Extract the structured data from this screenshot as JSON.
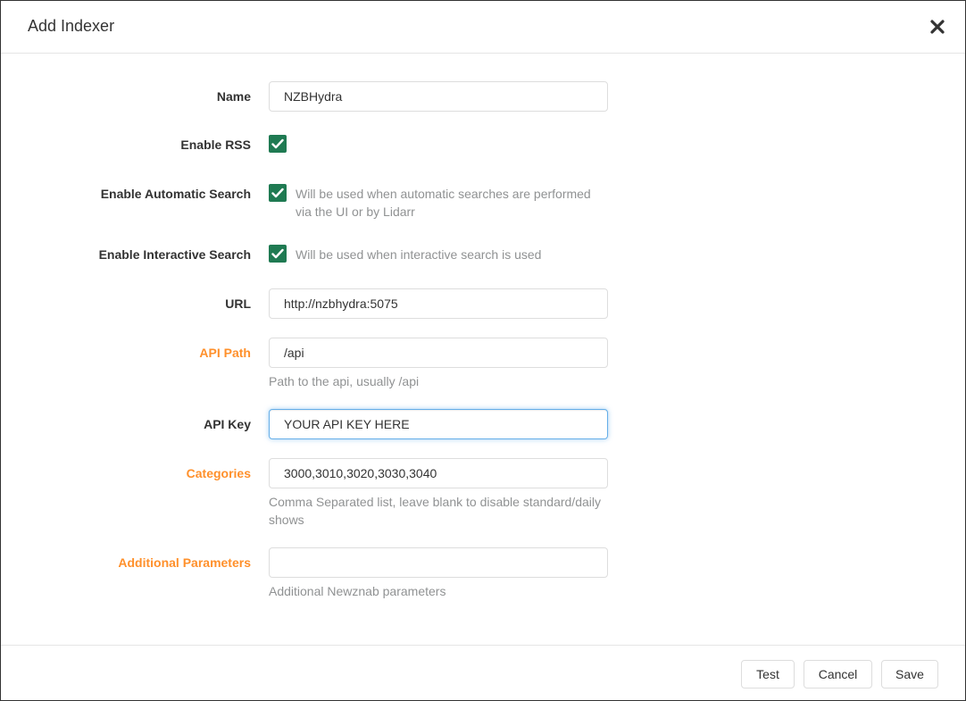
{
  "modal": {
    "title": "Add Indexer",
    "close_icon": "close-icon"
  },
  "colors": {
    "advanced_label": "#ff902b",
    "checkbox": "#1f7a52",
    "focus_border": "#66afe9"
  },
  "form": {
    "name": {
      "label": "Name",
      "value": "NZBHydra"
    },
    "enable_rss": {
      "label": "Enable RSS",
      "checked": true
    },
    "enable_automatic_search": {
      "label": "Enable Automatic Search",
      "checked": true,
      "help": "Will be used when automatic searches are performed via the UI or by Lidarr"
    },
    "enable_interactive_search": {
      "label": "Enable Interactive Search",
      "checked": true,
      "help": "Will be used when interactive search is used"
    },
    "url": {
      "label": "URL",
      "value": "http://nzbhydra:5075"
    },
    "api_path": {
      "label": "API Path",
      "value": "/api",
      "help": "Path to the api, usually /api"
    },
    "api_key": {
      "label": "API Key",
      "value": "YOUR API KEY HERE"
    },
    "categories": {
      "label": "Categories",
      "value": "3000,3010,3020,3030,3040",
      "help": "Comma Separated list, leave blank to disable standard/daily shows"
    },
    "additional_parameters": {
      "label": "Additional Parameters",
      "value": "",
      "help": "Additional Newznab parameters"
    }
  },
  "footer": {
    "test_label": "Test",
    "cancel_label": "Cancel",
    "save_label": "Save"
  }
}
